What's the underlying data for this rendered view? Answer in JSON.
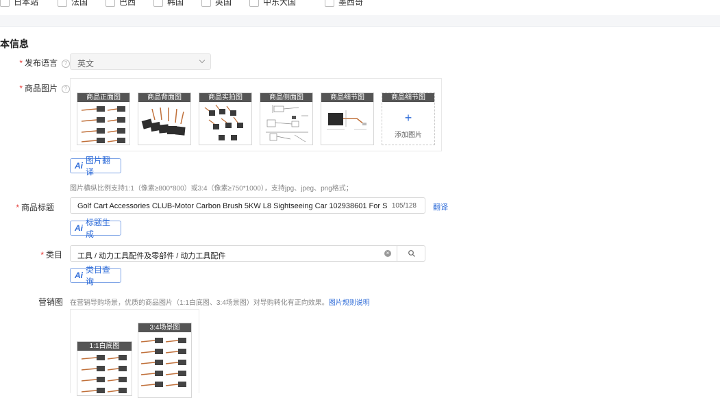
{
  "top_checkboxes": [
    "日本站",
    "法国",
    "巴西",
    "韩国",
    "英国",
    "中东大国",
    "墨西哥"
  ],
  "section_title": "本信息",
  "language": {
    "label": "发布语言",
    "value": "英文"
  },
  "images": {
    "label": "商品图片",
    "thumbs": [
      "商品正面图",
      "商品背面图",
      "商品实拍图",
      "商品侧面图",
      "商品细节图"
    ],
    "add_thumb_label": "商品细节图",
    "add_text": "添加图片",
    "translate_btn": "图片翻译",
    "hint": "图片横纵比例支持1:1（像素≥800*800）或3:4（像素≥750*1000），支持jpg、jpeg、png格式；"
  },
  "title": {
    "label": "商品标题",
    "value": "Golf Cart Accessories CLUB-Motor Carbon Brush 5KW L8 Sightseeing Car 102938601 For Sightseeing",
    "count": "105/128",
    "translate_link": "翻译",
    "gen_btn": "标题生成"
  },
  "category": {
    "label": "类目",
    "value": "工具 / 动力工具配件及零部件 / 动力工具配件",
    "query_btn": "类目查询"
  },
  "marketing": {
    "label": "营销图",
    "hint": "在营销导购场景，优质的商品图片（1:1白底图、3:4场景图）对导购转化有正向效果。",
    "hint_link": "图片规则说明",
    "thumb_1_1": "1:1白底图",
    "thumb_3_4": "3:4场景图"
  },
  "ai_label": "Ai",
  "required_mark": "*",
  "help_glyph": "?",
  "add_glyph": "+",
  "clear_glyph": "×",
  "colors": {
    "accent": "#2d6bd8",
    "required": "#e53935",
    "thumb_header": "#555555"
  }
}
